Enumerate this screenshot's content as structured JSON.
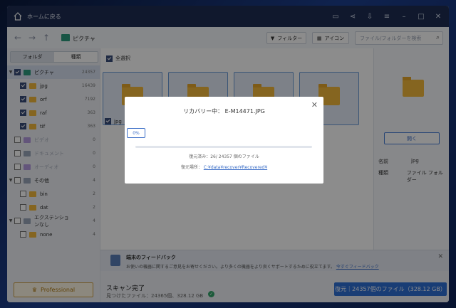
{
  "titlebar": {
    "back_home_label": "ホームに戻る"
  },
  "nav": {
    "breadcrumb": "ピクチャ"
  },
  "toolbar": {
    "filter_label": "フィルター",
    "icon_label": "アイコン",
    "search_placeholder": "ファイル/フォルダーを検索"
  },
  "sidebar": {
    "tab_folder": "フォルダ",
    "tab_type": "種類",
    "items": [
      {
        "label": "ピクチャ",
        "count": "24357"
      },
      {
        "label": "jpg",
        "count": "16439"
      },
      {
        "label": "orf",
        "count": "7192"
      },
      {
        "label": "raf",
        "count": "363"
      },
      {
        "label": "tif",
        "count": "363"
      },
      {
        "label": "ビデオ",
        "count": "0"
      },
      {
        "label": "ドキュメント",
        "count": "0"
      },
      {
        "label": "オーディオ",
        "count": "0"
      },
      {
        "label": "その他",
        "count": "4"
      },
      {
        "label": "bin",
        "count": "2"
      },
      {
        "label": "dat",
        "count": "2"
      },
      {
        "label": "エクステンションなし",
        "count": "4"
      },
      {
        "label": "none",
        "count": "4"
      }
    ],
    "pro_label": "Professional"
  },
  "content": {
    "select_all": "全選択",
    "first_thumb_label": "jpg"
  },
  "detail": {
    "open_label": "開く",
    "name_key": "名前",
    "name_val": "jpg",
    "type_key": "種類",
    "type_val": "ファイル フォルダー"
  },
  "feedback": {
    "title": "端末のフィードバック",
    "text": "お使いの機器に関するご意見をお寄せください。より多くの機器をより良くサポートするために役立てます。",
    "link": "今すぐフィードバック"
  },
  "status": {
    "done": "スキャン完了",
    "found": "見つけたファイル：24365個、328.12 GB",
    "recover_button": "復元｜24357個のファイル（328.12 GB）"
  },
  "modal": {
    "title": "リカバリー中：  E-M14471.JPG",
    "percent": "0%",
    "progress": 0.0,
    "recovered": "復元済み：26/ 24357 個のファイル",
    "location_label": "復元場所：",
    "location_path": "C:¥data¥recover¥Recovered¥"
  },
  "colors": {
    "accent": "#2f6fd6",
    "titlebar": "#1e2d52",
    "folder": "#f2b93b"
  }
}
